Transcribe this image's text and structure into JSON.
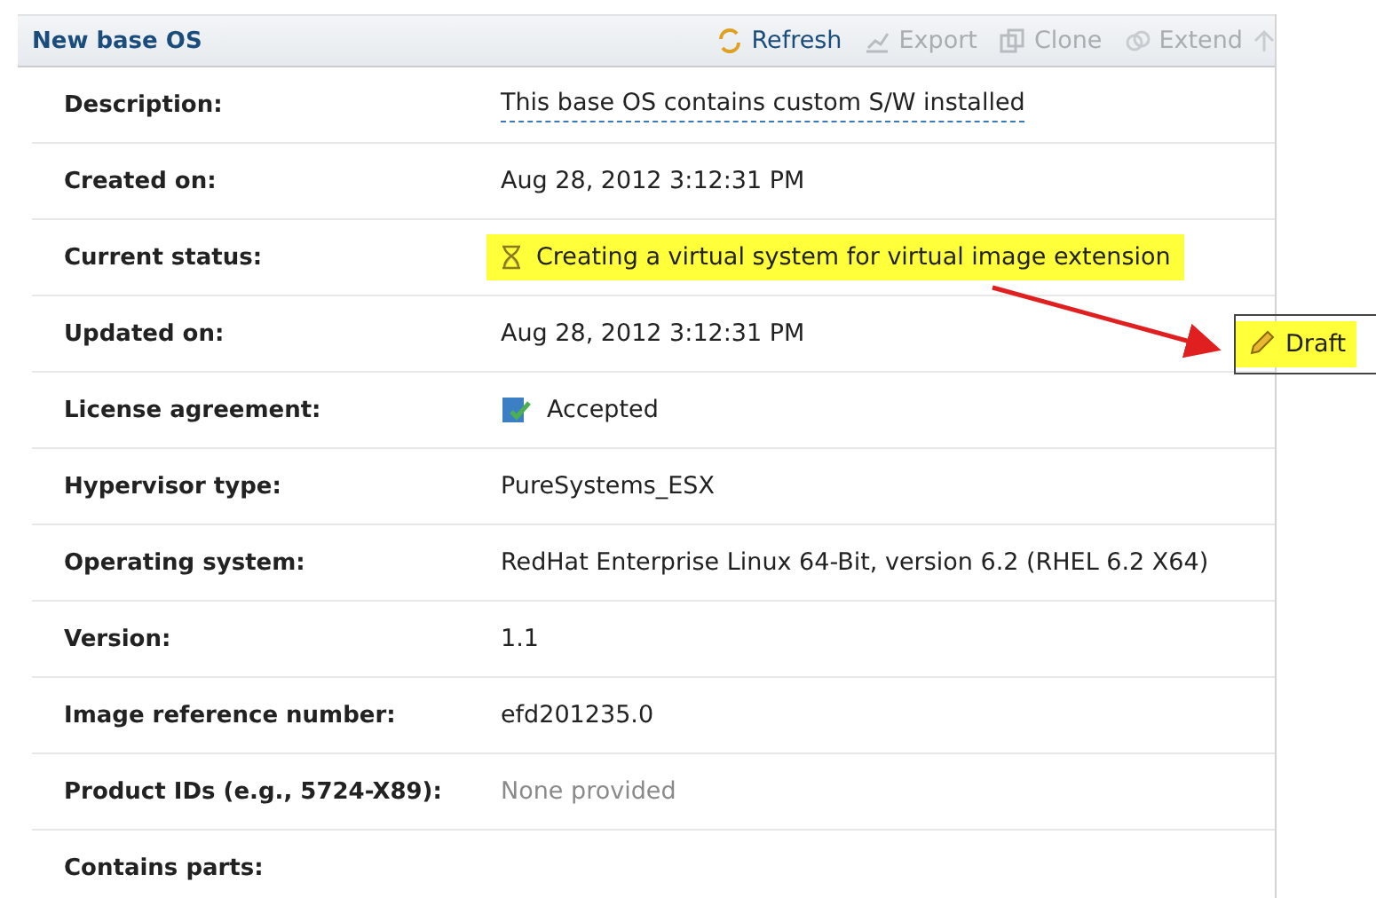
{
  "header": {
    "title": "New base OS",
    "actions": [
      {
        "label": "Refresh",
        "disabled": false
      },
      {
        "label": "Export",
        "disabled": true
      },
      {
        "label": "Clone",
        "disabled": true
      },
      {
        "label": "Extend",
        "disabled": true
      }
    ]
  },
  "rows": [
    {
      "label": "Description:",
      "value": "This base OS contains custom S/W installed",
      "kind": "editable"
    },
    {
      "label": "Created on:",
      "value": "Aug 28, 2012 3:12:31 PM",
      "kind": "text"
    },
    {
      "label": "Current status:",
      "value": "Creating a virtual system for virtual image extension",
      "kind": "status"
    },
    {
      "label": "Updated on:",
      "value": "Aug 28, 2012 3:12:31 PM",
      "kind": "text"
    },
    {
      "label": "License agreement:",
      "value": "Accepted",
      "kind": "accepted"
    },
    {
      "label": "Hypervisor type:",
      "value": "PureSystems_ESX",
      "kind": "text"
    },
    {
      "label": "Operating system:",
      "value": "RedHat Enterprise Linux 64-Bit, version 6.2 (RHEL 6.2 X64)",
      "kind": "text"
    },
    {
      "label": "Version:",
      "value": "1.1",
      "kind": "text"
    },
    {
      "label": "Image reference number:",
      "value": "efd201235.0",
      "kind": "text"
    },
    {
      "label": "Product IDs (e.g., 5724-X89):",
      "value": "None provided",
      "kind": "muted"
    },
    {
      "label": "Contains parts:"
    }
  ],
  "callout": {
    "label": "Draft"
  }
}
